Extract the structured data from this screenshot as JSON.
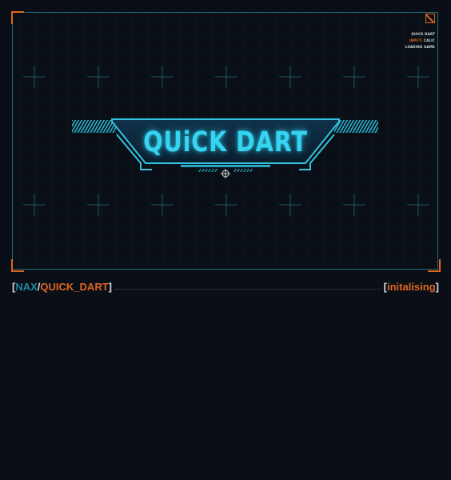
{
  "game": {
    "title": "QUiCK DART",
    "info_lines": [
      {
        "label": "",
        "value": "QUICK DART"
      },
      {
        "label": "INPUT:",
        "value": "CALIC"
      },
      {
        "label": "",
        "value": "LOADING GAME"
      }
    ]
  },
  "status_bar": {
    "open_bracket": "[",
    "nax": "NAX",
    "slash": "/",
    "game_name": "QUICK_DART",
    "close_bracket": "]",
    "status_open": "[",
    "status": "initalising",
    "status_close": "]"
  },
  "colors": {
    "background": "#0a0f17",
    "frame": "#1f6b73",
    "accent_cyan": "#34d4f2",
    "accent_orange": "#e0651f"
  }
}
